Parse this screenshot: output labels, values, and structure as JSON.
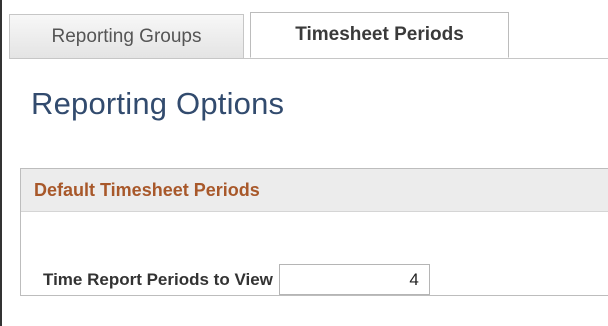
{
  "tabs": [
    {
      "label": "Reporting Groups",
      "active": false
    },
    {
      "label": "Timesheet Periods",
      "active": true
    }
  ],
  "page": {
    "title": "Reporting Options"
  },
  "group": {
    "header": "Default Timesheet Periods",
    "field_label": "Time Report Periods to View",
    "field_value": "4"
  },
  "colors": {
    "title": "#324b6e",
    "group_header_text": "#a8582a",
    "group_header_bg": "#ececec"
  }
}
